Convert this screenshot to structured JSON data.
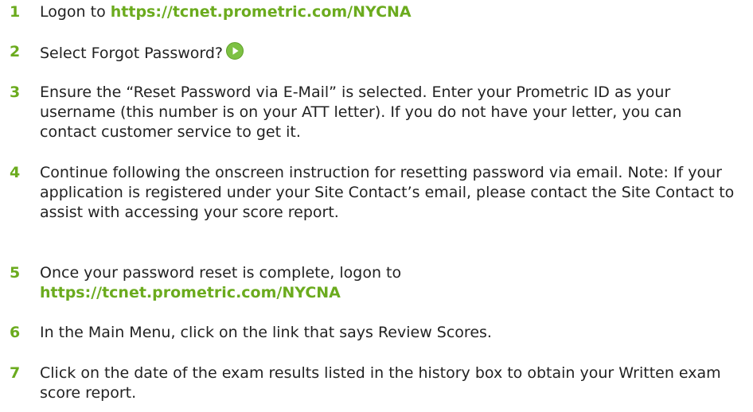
{
  "steps": [
    {
      "num": "1",
      "text_before": "Logon to ",
      "link": "https://tcnet.prometric.com/NYCNA"
    },
    {
      "num": "2",
      "text": "Select Forgot Password?",
      "icon": "play-icon",
      "icon_color": "#7dc143"
    },
    {
      "num": "3",
      "text": "Ensure the “Reset Password via E-Mail” is selected. Enter your Prometric ID as your username (this number is on your ATT letter). If you do not have your letter, you can contact customer service to get it."
    },
    {
      "num": "4",
      "text": "Continue following the onscreen instruction for resetting password via email. Note: If your application is registered under your Site Contact’s email, please contact the Site Contact to assist with accessing your score report."
    },
    {
      "num": "5",
      "text_before": "Once your password reset is complete, logon to",
      "link": "https://tcnet.prometric.com/NYCNA"
    },
    {
      "num": "6",
      "text": "In the Main Menu, click on the link that says Review Scores."
    },
    {
      "num": "7",
      "text": "Click on the date of the exam results listed in the history box to obtain your Written exam score report."
    }
  ],
  "colors": {
    "accent": "#6bab1e",
    "text": "#222222"
  }
}
